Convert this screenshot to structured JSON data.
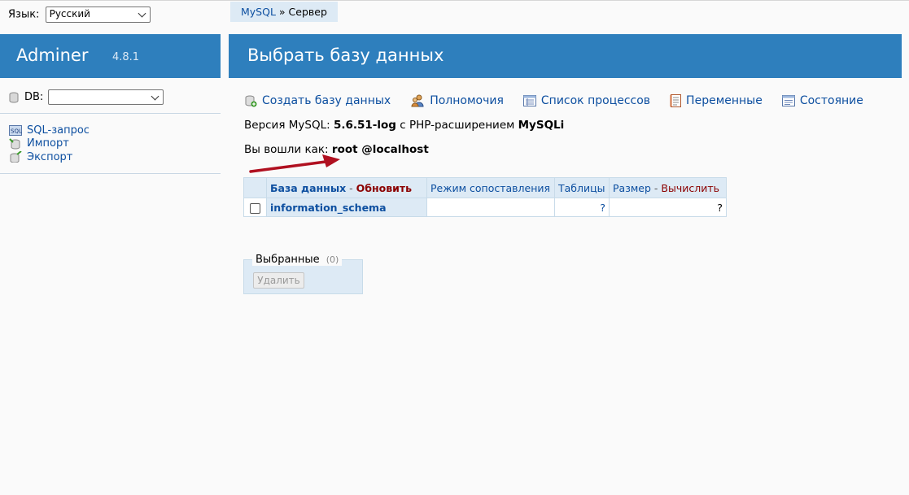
{
  "lang": {
    "label": "Язык:",
    "selected": "Русский"
  },
  "breadcrumb": {
    "link": "MySQL",
    "sep": " » ",
    "current": "Сервер"
  },
  "app": {
    "name": "Adminer",
    "version": "4.8.1"
  },
  "page": {
    "title": "Выбрать базу данных"
  },
  "sidebar": {
    "db_label": "DB:",
    "db_selected": "",
    "links": [
      {
        "label": "SQL-запрос",
        "icon": "sql-icon"
      },
      {
        "label": "Импорт",
        "icon": "import-icon"
      },
      {
        "label": "Экспорт",
        "icon": "export-icon"
      }
    ]
  },
  "main_links": [
    {
      "label": "Создать базу данных",
      "icon": "create-db-icon"
    },
    {
      "label": "Полномочия",
      "icon": "users-icon"
    },
    {
      "label": "Список процессов",
      "icon": "process-list-icon"
    },
    {
      "label": "Переменные",
      "icon": "variables-icon"
    },
    {
      "label": "Состояние",
      "icon": "status-icon"
    }
  ],
  "version_info": {
    "prefix": "Версия MySQL: ",
    "version": "5.6.51-log",
    "middle": " с PHP-расширением ",
    "ext": "MySQLi"
  },
  "login_info": {
    "prefix": "Вы вошли как: ",
    "user": "root @localhost"
  },
  "table": {
    "headers": {
      "database": "База данных",
      "sep1": " - ",
      "refresh": "Обновить",
      "collation": "Режим сопоставления",
      "tables": "Таблицы",
      "size": "Размер",
      "sep2": " - ",
      "compute": "Вычислить"
    },
    "rows": [
      {
        "name": "information_schema",
        "collation": "",
        "tables": "?",
        "size": "?"
      }
    ]
  },
  "selected": {
    "legend": "Выбранные",
    "count": "(0)",
    "delete_label": "Удалить"
  },
  "colors": {
    "accent": "#2e7fbd",
    "light": "#ddeaf5",
    "link": "#0d4fa0",
    "arrow": "#b01020"
  }
}
